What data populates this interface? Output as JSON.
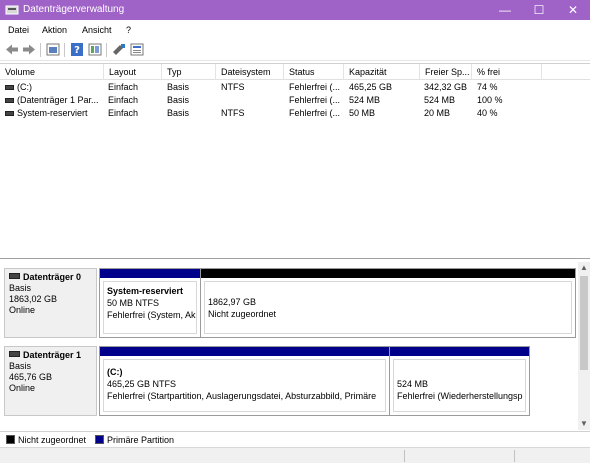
{
  "window": {
    "title": "Datenträgerverwaltung",
    "minimize": "—",
    "maximize": "☐",
    "close": "✕",
    "titlebar_color": "#9f63c8"
  },
  "menu": {
    "items": [
      "Datei",
      "Aktion",
      "Ansicht",
      "?"
    ]
  },
  "toolbar": {
    "buttons": [
      "back-icon",
      "forward-icon",
      "properties-icon",
      "help-icon",
      "refresh-icon",
      "connect-icon",
      "list-view-icon"
    ]
  },
  "volume_list": {
    "columns": [
      "Volume",
      "Layout",
      "Typ",
      "Dateisystem",
      "Status",
      "Kapazität",
      "Freier Sp...",
      "% frei"
    ],
    "rows": [
      [
        "(C:)",
        "Einfach",
        "Basis",
        "NTFS",
        "Fehlerfrei (...",
        "465,25 GB",
        "342,32 GB",
        "74 %"
      ],
      [
        "(Datenträger 1 Par...",
        "Einfach",
        "Basis",
        "",
        "Fehlerfrei (...",
        "524 MB",
        "524 MB",
        "100 %"
      ],
      [
        "System-reserviert",
        "Einfach",
        "Basis",
        "NTFS",
        "Fehlerfrei (...",
        "50 MB",
        "20 MB",
        "40 %"
      ]
    ]
  },
  "disks": [
    {
      "name": "Datenträger 0",
      "type": "Basis",
      "size": "1863,02 GB",
      "state": "Online",
      "partitions": [
        {
          "name": "System-reserviert",
          "size": "50 MB NTFS",
          "status": "Fehlerfrei (System, Ak",
          "kind": "primary"
        },
        {
          "name": "",
          "size": "1862,97 GB",
          "status": "Nicht zugeordnet",
          "kind": "unallocated"
        }
      ]
    },
    {
      "name": "Datenträger 1",
      "type": "Basis",
      "size": "465,76 GB",
      "state": "Online",
      "partitions": [
        {
          "name": "(C:)",
          "size": "465,25 GB NTFS",
          "status": "Fehlerfrei (Startpartition, Auslagerungsdatei, Absturzabbild, Primäre",
          "kind": "primary"
        },
        {
          "name": "",
          "size": "524 MB",
          "status": "Fehlerfrei (Wiederherstellungsp",
          "kind": "primary"
        }
      ]
    }
  ],
  "legend": {
    "unallocated": "Nicht zugeordnet",
    "primary": "Primäre Partition",
    "unallocated_color": "#000000",
    "primary_color": "#00008b"
  }
}
